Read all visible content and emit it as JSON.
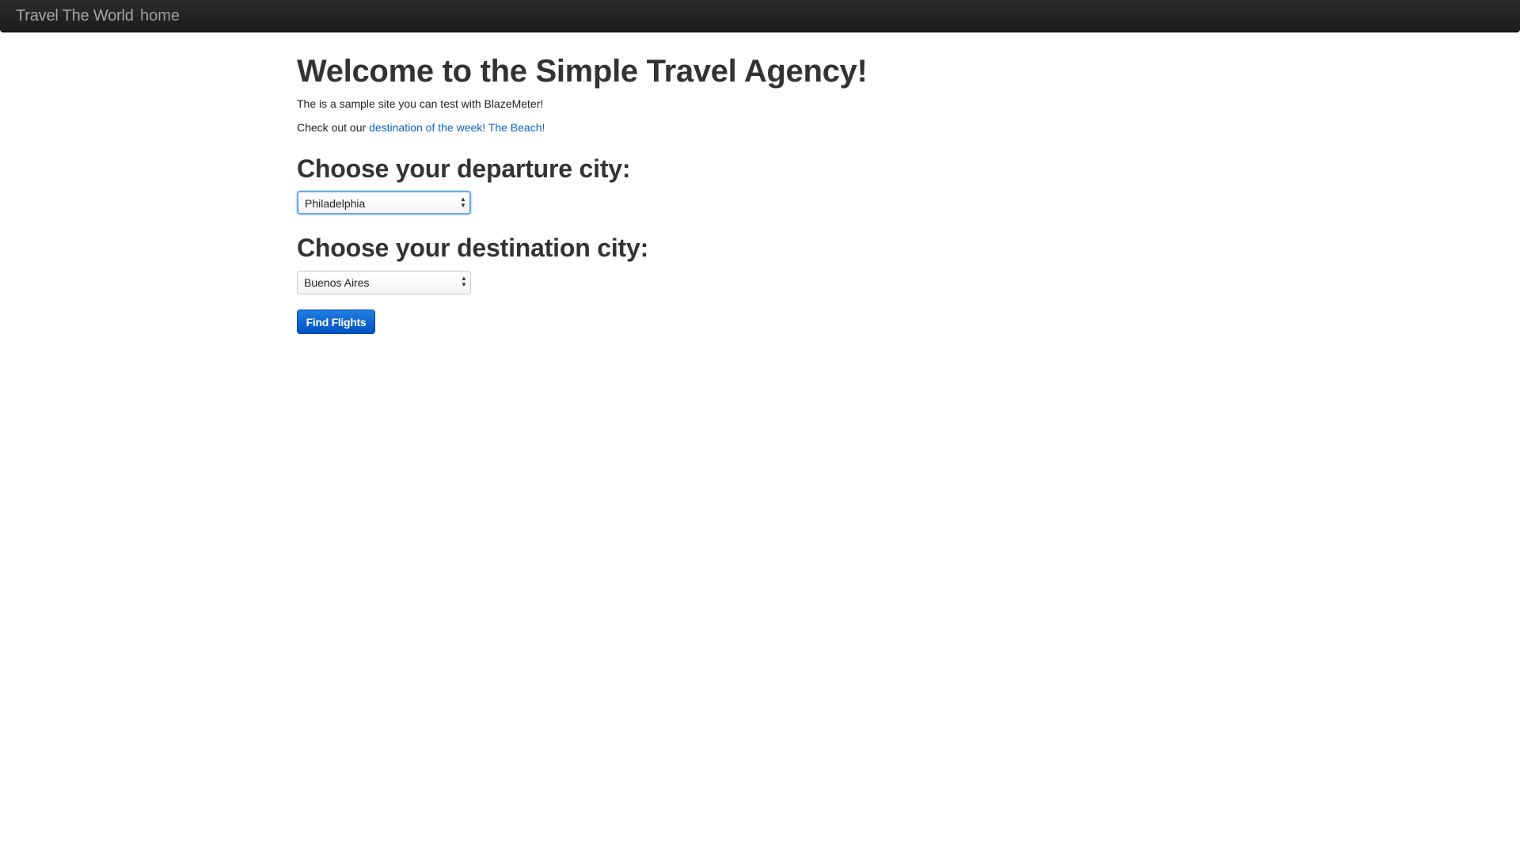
{
  "navbar": {
    "brand": "Travel The World",
    "links": [
      "home"
    ]
  },
  "main": {
    "heading": "Welcome to the Simple Travel Agency!",
    "intro": "The is a sample site you can test with BlazeMeter!",
    "promo_prefix": "Check out our ",
    "promo_link": "destination of the week! The Beach!",
    "departure_heading": "Choose your departure city:",
    "departure_selected": "Philadelphia",
    "destination_heading": "Choose your destination city:",
    "destination_selected": "Buenos Aires",
    "submit_label": "Find Flights"
  },
  "colors": {
    "navbar_bg": "#1b1b1b",
    "link": "#0b63c5",
    "button_bg": "#0052c4",
    "focus_ring": "#6aa7e6"
  },
  "icons": {
    "select_arrows": "updown-arrows-icon"
  }
}
